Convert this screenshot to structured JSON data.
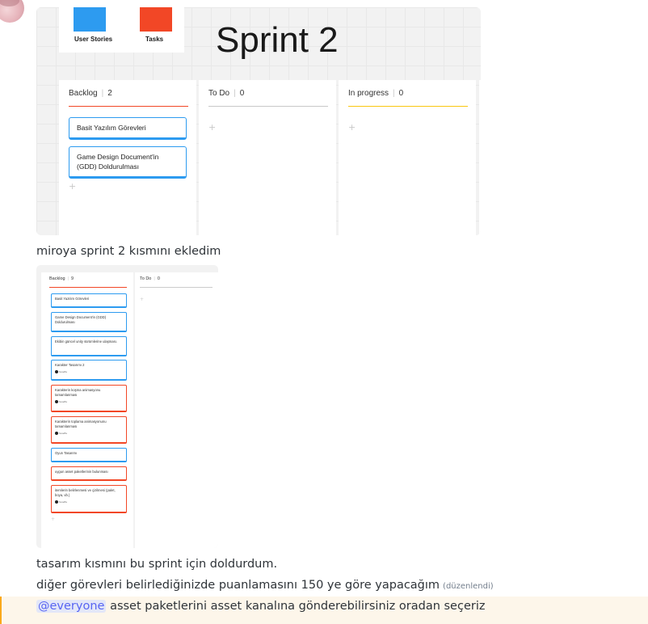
{
  "colors": {
    "blue_note": "#2d9bf0",
    "red_note": "#f24726",
    "progress_yellow": "#fac710",
    "mention": "#5865f2",
    "highlight": "#fdf6ea"
  },
  "board1": {
    "legend": {
      "stories_label": "User Stories",
      "tasks_label": "Tasks"
    },
    "title": "Sprint 2",
    "columns": [
      {
        "name": "Backlog",
        "count": "2"
      },
      {
        "name": "To Do",
        "count": "0"
      },
      {
        "name": "In progress",
        "count": "0"
      }
    ],
    "backlog_cards": [
      "Basit Yazılım Görevleri",
      "Game Design Document'in (GDD) Doldurulması"
    ],
    "add_symbol": "+"
  },
  "messages": {
    "m1": "miroya sprint 2 kısmını ekledim",
    "m2": "tasarım kısmını bu sprint için doldurdum.",
    "m3": "diğer görevleri belirlediğinizde puanlamasını 150 ye göre yapacağım",
    "m3_edited": "(düzenlendi)",
    "m4_mention": "@everyone",
    "m4_text": "asset paketlerini asset kanalına gönderebilirsiniz oradan seçeriz"
  },
  "board2": {
    "columns": [
      {
        "name": "Backlog",
        "count": "9"
      },
      {
        "name": "To Do",
        "count": "0"
      }
    ],
    "cards": [
      {
        "text": "Basit Yazılım Görevleri",
        "tag": ""
      },
      {
        "text": "Game Design Document'in (GDD) Doldurulması",
        "tag": ""
      },
      {
        "text": "Ekibin güncel unity sürümlerine ulaşması.",
        "tag": ""
      },
      {
        "text": "Karakter Tasarımı 2",
        "tag": "huseffa"
      },
      {
        "text": "Karakterin koşma animasyonu tamamlanması",
        "tag": "huseffa"
      },
      {
        "text": "Karakterin toplama animasyonunu tamamlanması",
        "tag": "huseffa"
      },
      {
        "text": "Oyun Tasarımı",
        "tag": ""
      },
      {
        "text": "uygun asset paketlerinin bulunması",
        "tag": ""
      },
      {
        "text": "itemlerin belirlenmesi ve çizilmesi (palet, boya, vb.)",
        "tag": "huseffa"
      }
    ],
    "add_symbol": "+"
  }
}
